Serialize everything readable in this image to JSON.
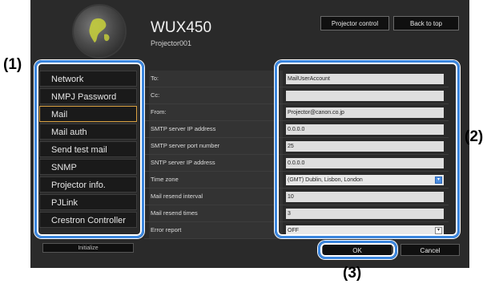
{
  "header": {
    "model": "WUX450",
    "projector_name": "Projector001",
    "projector_control_label": "Projector control",
    "back_to_top_label": "Back to top"
  },
  "sidebar": {
    "items": [
      {
        "label": "Network"
      },
      {
        "label": "NMPJ Password"
      },
      {
        "label": "Mail",
        "active": true
      },
      {
        "label": "Mail auth"
      },
      {
        "label": "Send test mail"
      },
      {
        "label": "SNMP"
      },
      {
        "label": "Projector info."
      },
      {
        "label": "PJLink"
      },
      {
        "label": "Crestron Controller"
      }
    ],
    "initialize_label": "Initialize"
  },
  "form": {
    "fields": [
      {
        "label": "To:",
        "value": "MailUserAccount"
      },
      {
        "label": "Cc:",
        "value": ""
      },
      {
        "label": "From:",
        "value": "Projector@canon.co.jp"
      },
      {
        "label": "SMTP server IP address",
        "value": "0.0.0.0"
      },
      {
        "label": "SMTP server port number",
        "value": "25"
      },
      {
        "label": "SNTP server IP address",
        "value": "0.0.0.0"
      },
      {
        "label": "Time zone",
        "value": "(GMT) Dublin, Lisbon, London"
      },
      {
        "label": "Mail resend interval",
        "value": "10"
      },
      {
        "label": "Mail resend times",
        "value": "3"
      },
      {
        "label": "Error report",
        "value": "OFF"
      }
    ],
    "ok_label": "OK",
    "cancel_label": "Cancel"
  },
  "callouts": {
    "one": "(1)",
    "two": "(2)",
    "three": "(3)"
  },
  "colors": {
    "panel_bg": "#2a2a2a",
    "highlight": "#3b86de",
    "active_border": "#d8a040"
  },
  "icons": [
    "canon-globe-logo-icon",
    "select-arrow-icon"
  ]
}
